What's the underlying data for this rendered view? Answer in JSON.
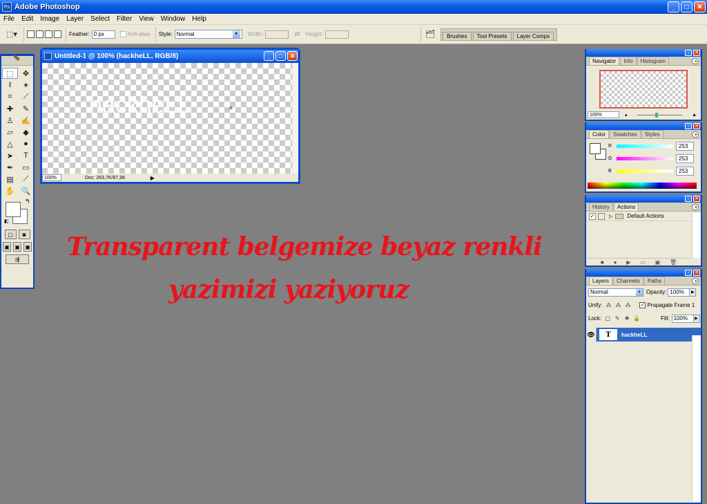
{
  "app": {
    "title": "Adobe Photoshop",
    "icon": "photoshop-icon"
  },
  "window_buttons": {
    "minimize": "_",
    "maximize": "□",
    "close": "✕"
  },
  "menu": [
    "File",
    "Edit",
    "Image",
    "Layer",
    "Select",
    "Filter",
    "View",
    "Window",
    "Help"
  ],
  "options": {
    "feather_label": "Feather:",
    "feather_value": "0 px",
    "antialias_label": "Anti-alias",
    "style_label": "Style:",
    "style_value": "Normal",
    "width_label": "Width:",
    "height_label": "Height:"
  },
  "palette_well": [
    "Brushes",
    "Tool Presets",
    "Layer Comps"
  ],
  "document": {
    "title": "Untitled-1 @ 100% (hackheLL, RGB/8)",
    "canvas_text": "hackheLL",
    "zoom": "100%",
    "doc_info": "Doc: 263,7K/87,9K"
  },
  "annotation": {
    "line1": "Transparent belgemize beyaz renkli",
    "line2": "yazimizi yaziyoruz",
    "color": "#e8141c"
  },
  "navigator": {
    "tabs": [
      "Navigator",
      "Info",
      "Histogram"
    ],
    "zoom": "100%"
  },
  "color": {
    "tabs": [
      "Color",
      "Swatches",
      "Styles"
    ],
    "channels": [
      {
        "label": "R",
        "value": "253"
      },
      {
        "label": "G",
        "value": "253"
      },
      {
        "label": "B",
        "value": "253"
      }
    ]
  },
  "actions": {
    "tabs": [
      "History",
      "Actions"
    ],
    "items": [
      {
        "label": "Default Actions"
      }
    ]
  },
  "layers": {
    "tabs": [
      "Layers",
      "Channels",
      "Paths"
    ],
    "blend_mode": "Normal",
    "opacity_label": "Opacity:",
    "opacity_value": "100%",
    "unify_label": "Unify:",
    "propagate_label": "Propagate Frame 1",
    "lock_label": "Lock:",
    "fill_label": "Fill:",
    "fill_value": "100%",
    "items": [
      {
        "name": "hackheLL",
        "type_glyph": "T"
      }
    ]
  }
}
